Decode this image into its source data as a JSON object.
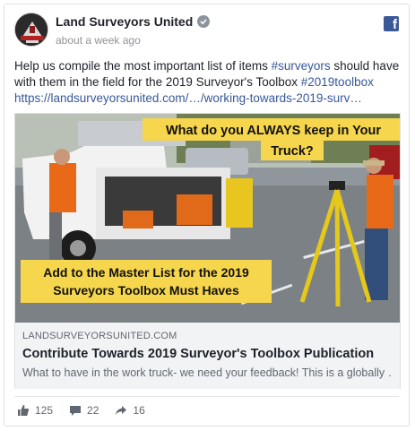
{
  "post": {
    "page_name": "Land Surveyors United",
    "timestamp": "about a week ago",
    "text_before": "Help us compile the most important list of items ",
    "hashtag_1": "#surveyors",
    "text_middle": " should have with them in the field for the 2019 Surveyor's Toolbox ",
    "hashtag_2": "#2019toolbox",
    "link_text": "https://landsurveyorsunited.com/…/working-towards-2019-surv…"
  },
  "image": {
    "banner_top_line1": "What do you ALWAYS keep in Your",
    "banner_top_line2": "Truck?",
    "banner_bottom_line1": "Add to the Master List for the 2019",
    "banner_bottom_line2": "Surveyors Toolbox Must Haves"
  },
  "link_preview": {
    "domain": "LANDSURVEYORSUNITED.COM",
    "title": "Contribute Towards 2019 Surveyor's Toolbox Publication",
    "description": "What to have in the work truck- we need your feedback! This is a globally …"
  },
  "stats": {
    "likes": "125",
    "comments": "22",
    "shares": "16"
  },
  "icons": {
    "platform": "facebook-icon",
    "verified": "verified-badge-icon",
    "like": "thumbs-up-icon",
    "comment": "comment-icon",
    "share": "share-arrow-icon"
  },
  "colors": {
    "link": "#365899",
    "banner": "#f6d64c",
    "facebook": "#3b5998"
  }
}
